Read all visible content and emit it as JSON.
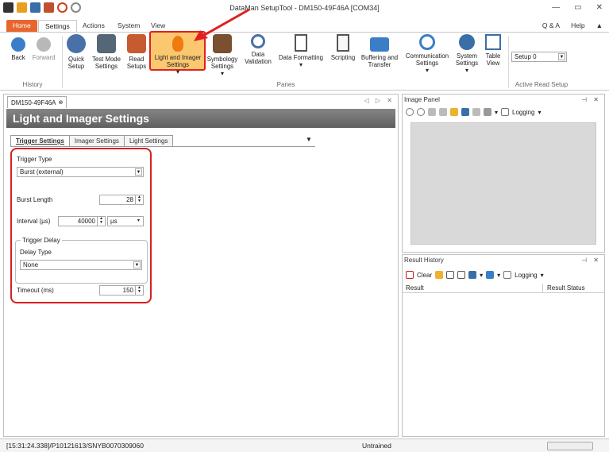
{
  "window": {
    "title": "DataMan SetupTool - DM150-49F46A [COM34]",
    "minimize": "—",
    "restore": "▭",
    "close": "✕"
  },
  "ribbon_tabs": [
    "Home",
    "Settings",
    "Actions",
    "System",
    "View"
  ],
  "help_links": {
    "qa": "Q & A",
    "help": "Help",
    "collapse": "▲"
  },
  "ribbon": {
    "history": {
      "label": "History",
      "back": "Back",
      "forward": "Forward"
    },
    "panes": {
      "label": "Panes",
      "quick_setup": [
        "Quick",
        "Setup"
      ],
      "test_mode": [
        "Test Mode",
        "Settings"
      ],
      "read_setups": [
        "Read",
        "Setups"
      ],
      "light_imager": [
        "Light and Imager",
        "Settings"
      ],
      "symbology": [
        "Symbology",
        "Settings"
      ],
      "data_validation": [
        "Data",
        "Validation"
      ],
      "data_formatting": "Data Formatting",
      "scripting": "Scripting",
      "buffering": [
        "Buffering and",
        "Transfer"
      ],
      "communication": [
        "Communication",
        "Settings"
      ],
      "system_settings": [
        "System",
        "Settings"
      ],
      "table_view": [
        "Table",
        "View"
      ]
    },
    "active_read_setup": {
      "label": "Active Read Setup",
      "value": "Setup 0"
    },
    "colors": {
      "accent": "#e8662e",
      "highlight": "#fbc870",
      "callout": "#e02020"
    }
  },
  "document": {
    "tab": "DM150-49F46A",
    "tab_controls": "◁ ▷ ✕",
    "heading": "Light and Imager Settings",
    "subtabs": [
      "Trigger Settings",
      "Imager Settings",
      "Light Settings"
    ],
    "trigger_type": {
      "label": "Trigger Type",
      "value": "Burst (external)"
    },
    "burst_length": {
      "label": "Burst Length",
      "value": "28"
    },
    "interval": {
      "label": "Interval (µs)",
      "value": "40000",
      "unit": "µs"
    },
    "trigger_delay": {
      "group": "Trigger Delay",
      "delay_type_label": "Delay Type",
      "delay_type_value": "None"
    },
    "timeout": {
      "label": "Timeout (ms)",
      "value": "150"
    }
  },
  "image_panel": {
    "title": "Image Panel",
    "controls": "⊣ ✕",
    "logging": "Logging"
  },
  "result_history": {
    "title": "Result History",
    "controls": "⊣ ✕",
    "clear": "Clear",
    "logging": "Logging",
    "columns": [
      "Result",
      "Result Status"
    ]
  },
  "status": {
    "left": "[15:31:24.338]/P10121613/SNYB0070309060",
    "center": "Untrained"
  }
}
